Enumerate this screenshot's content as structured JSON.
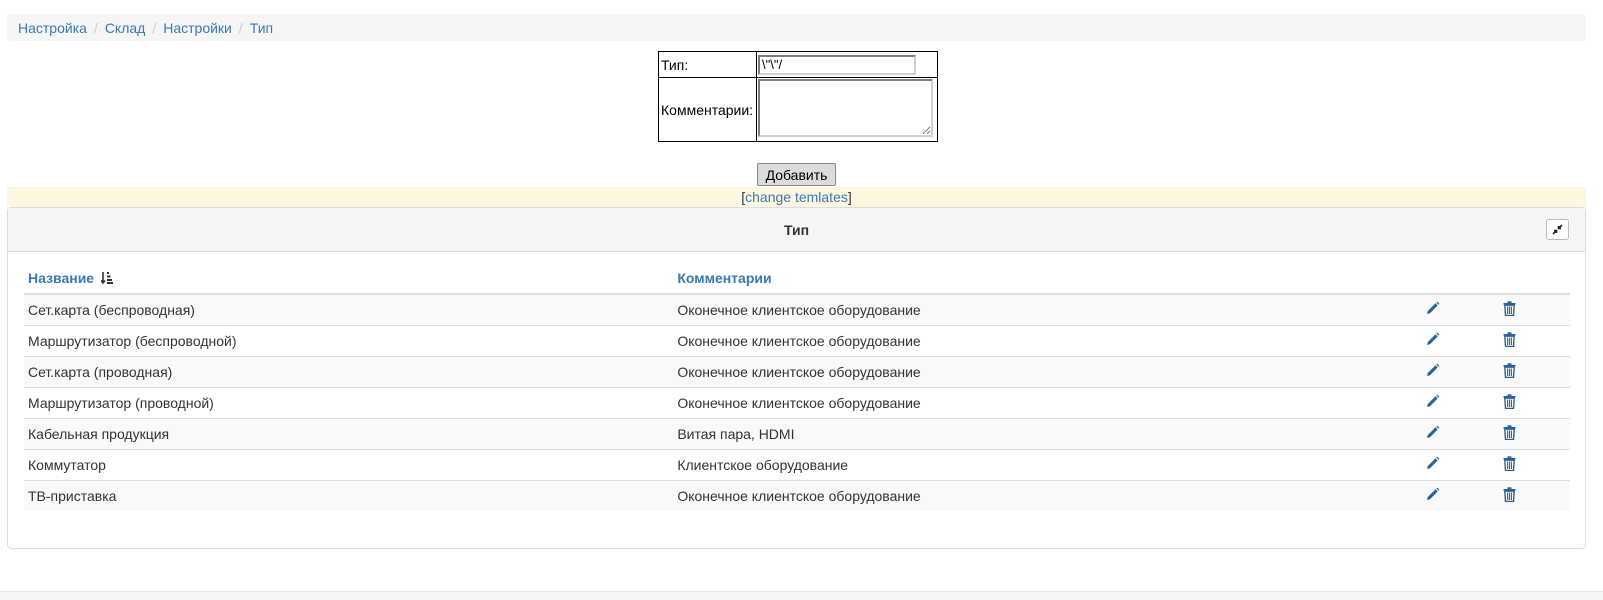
{
  "breadcrumb": {
    "items": [
      "Настройка",
      "Склад",
      "Настройки",
      "Тип"
    ],
    "separator": "/"
  },
  "form": {
    "type_label": "Тип:",
    "type_value": "\\\"\\\"/",
    "comment_label": "Комментарии:",
    "comment_value": "",
    "submit_label": "Добавить"
  },
  "templates": {
    "open": "[",
    "link": "change temlates",
    "close": "]"
  },
  "panel": {
    "title": "Тип",
    "collapse_icon": "compress-icon",
    "columns": {
      "name": "Название",
      "comment": "Комментарии"
    },
    "sort_icon": "sort-amount-icon",
    "rows": [
      {
        "name": "Сет.карта (беспроводная)",
        "comment": "Оконечное клиентское оборудование"
      },
      {
        "name": "Маршрутизатор (беспроводной)",
        "comment": "Оконечное клиентское оборудование"
      },
      {
        "name": "Сет.карта (проводная)",
        "comment": "Оконечное клиентское оборудование"
      },
      {
        "name": "Маршрутизатор (проводной)",
        "comment": "Оконечное клиентское оборудование"
      },
      {
        "name": "Кабельная продукция",
        "comment": "Витая пара, HDMI"
      },
      {
        "name": "Коммутатор",
        "comment": "Клиентское оборудование"
      },
      {
        "name": "ТВ-приставка",
        "comment": "Оконечное клиентское оборудование"
      }
    ],
    "row_icons": {
      "edit": "pencil-icon",
      "delete": "trash-icon"
    }
  },
  "colors": {
    "link": "#3a79b3",
    "icon": "#2a6496",
    "notice_bg": "#fdf7e1"
  }
}
